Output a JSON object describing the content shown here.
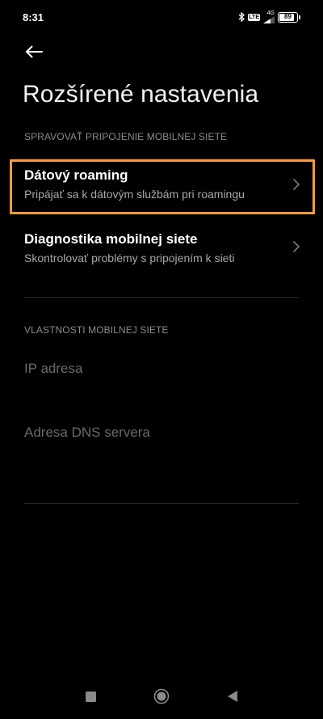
{
  "status_bar": {
    "time": "8:31",
    "network": "4G",
    "lte_badge": "LTE",
    "battery_level": "89",
    "battery_fraction": 0.89,
    "icons": [
      "bluetooth-icon",
      "volte-icon",
      "signal-icon",
      "battery-icon"
    ]
  },
  "header": {
    "back_icon": "arrow-left-icon",
    "title": "Rozšírené nastavenia"
  },
  "sections": {
    "manage_connection": {
      "header": "SPRAVOVAŤ PRIPOJENIE MOBILNEJ SIETE",
      "items": [
        {
          "title": "Dátový roaming",
          "subtitle": "Pripájať sa k dátovým službám pri roamingu",
          "highlighted": true
        },
        {
          "title": "Diagnostika mobilnej siete",
          "subtitle": "Skontrolovať problémy s pripojením k sieti"
        }
      ]
    },
    "network_properties": {
      "header": "VLASTNOSTI MOBILNEJ SIETE",
      "items": [
        {
          "title": "IP adresa"
        },
        {
          "title": "Adresa DNS servera"
        }
      ]
    }
  },
  "highlight_color": "#ff9a3c",
  "nav_bar": {
    "icons": [
      "recents-square-icon",
      "home-circle-icon",
      "back-triangle-icon"
    ]
  }
}
